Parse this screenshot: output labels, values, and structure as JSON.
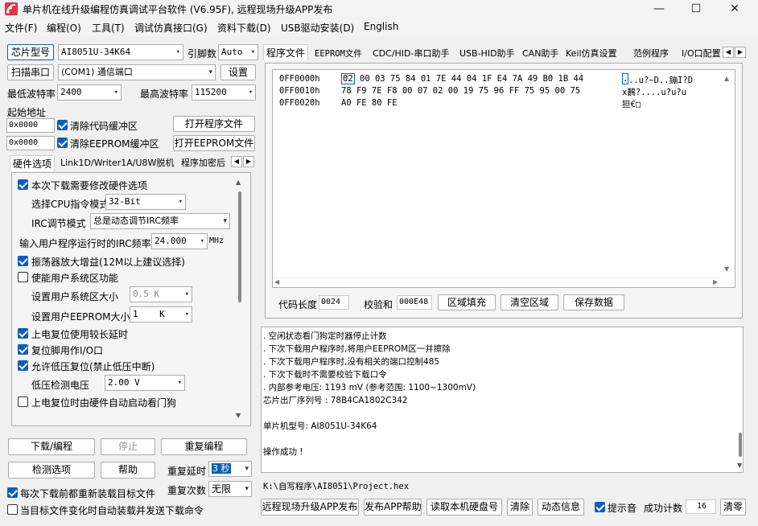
{
  "window": {
    "title": "单片机在线升级编程仿真调试平台软件 (V6.95F), 远程现场升级APP发布",
    "minimize": "—",
    "maximize": "☐",
    "close": "✕"
  },
  "menu": [
    "文件(F)",
    "编程(O)",
    "工具(T)",
    "调试仿真接口(G)",
    "资料下载(D)",
    "USB驱动安装(D)",
    "English"
  ],
  "left": {
    "chip_btn": "芯片型号",
    "chip_value": "AI8051U-34K64",
    "pin_label": "引脚数",
    "pin_value": "Auto",
    "scan_btn": "扫描串口",
    "port_value": "(COM1) 通信端口",
    "settings_btn": "设置",
    "min_baud_label": "最低波特率",
    "min_baud_value": "2400",
    "max_baud_label": "最高波特率",
    "max_baud_value": "115200",
    "start_addr_label": "起始地址",
    "addr1": "0x0000",
    "clear_code": "清除代码缓冲区",
    "open_prog_btn": "打开程序文件",
    "addr2": "0x0000",
    "clear_eeprom": "清除EEPROM缓冲区",
    "open_eeprom_btn": "打开EEPROM文件"
  },
  "hw_tabs": [
    "硬件选项",
    "Link1D/Writer1A/U8W脱机",
    "程序加密后"
  ],
  "hw": {
    "modify": "本次下载需要修改硬件选项",
    "cpu_mode_label": "选择CPU指令模式",
    "cpu_mode_value": "32-Bit",
    "irc_mode_label": "IRC调节模式",
    "irc_mode_value": "总是动态调节IRC频率",
    "irc_freq_label": "输入用户程序运行时的IRC频率",
    "irc_freq_value": "24.000",
    "irc_unit": "MHz",
    "osc_gain": "振荡器放大增益(12M以上建议选择)",
    "sys_area": "使能用户系统区功能",
    "sys_size_label": "设置用户系统区大小",
    "sys_size_value": "0.5 K",
    "eeprom_size_label": "设置用户EEPROM大小",
    "eeprom_size_value": "1    K",
    "long_delay": "上电复位使用较长延时",
    "reset_io": "复位脚用作I/O口",
    "lvr": "允许低压复位(禁止低压中断)",
    "lvd_label": "低压检测电压",
    "lvd_value": "2.00 V",
    "wdt": "上电复位时由硬件自动启动看门狗"
  },
  "bottom_left": {
    "download_btn": "下载/编程",
    "stop_btn": "停止",
    "reprog_btn": "重复编程",
    "detect_btn": "检测选项",
    "help_btn": "帮助",
    "repeat_delay_label": "重复延时",
    "repeat_delay_value": "3 秒",
    "reload_label": "每次下载前都重新装载目标文件",
    "repeat_count_label": "重复次数",
    "repeat_count_value": "无限",
    "auto_load_label": "当目标文件变化时自动装载并发送下载命令"
  },
  "right_tabs": [
    "程序文件",
    "EEPROM文件",
    "CDC/HID-串口助手",
    "USB-HID助手",
    "CAN助手",
    "Keil仿真设置",
    "范例程序",
    "I/O口配置"
  ],
  "hex": {
    "rows": [
      {
        "addr": "0FF0000h",
        "sel": "02",
        "bytes": "00 03 75 84 01 7E 44 04 1F E4 7A 49 B0 1B 44",
        "ascii_sel": ".",
        "ascii": "..u?~D..鏰I?D"
      },
      {
        "addr": "0FF0010h",
        "sel": "",
        "bytes": "78 F9 7E F8 00 07 02 00 19 75 96 FF 75 95 00 75",
        "ascii_sel": "",
        "ascii": "x鶈?....u?u?u"
      },
      {
        "addr": "0FF0020h",
        "sel": "",
        "bytes": "A0 FE 80 FE",
        "ascii_sel": "",
        "ascii": "狚€□"
      }
    ]
  },
  "code_info": {
    "len_label": "代码长度",
    "len_value": "0024",
    "checksum_label": "校验和",
    "checksum_value": "000E48",
    "fill_btn": "区域填充",
    "clear_btn": "清空区域",
    "save_btn": "保存数据"
  },
  "log": [
    "  . 空闲状态看门狗定时器停止计数",
    "  . 下次下载用户程序时,将用户EEPROM区一并擦除",
    "  . 下次下载用户程序时,没有相关的端口控制485",
    "  . 下次下载时不需要校验下载口令",
    "  . 内部参考电压: 1193 mV (参考范围: 1100~1300mV)",
    "芯片出厂序列号 : 78B4CA1802C342",
    "",
    "  单片机型号: AI8051U-34K64",
    "",
    "操作成功 !"
  ],
  "path": "K:\\自写程序\\AI8051\\Project.hex",
  "bottom_bar": {
    "remote_btn": "远程现场升级APP发布",
    "app_help_btn": "发布APP帮助",
    "read_disk_btn": "读取本机硬盘号",
    "clear_btn": "清除",
    "dynamic_btn": "动态信息",
    "beep_label": "提示音",
    "success_label": "成功计数",
    "success_value": "16",
    "clear2_btn": "清零"
  }
}
